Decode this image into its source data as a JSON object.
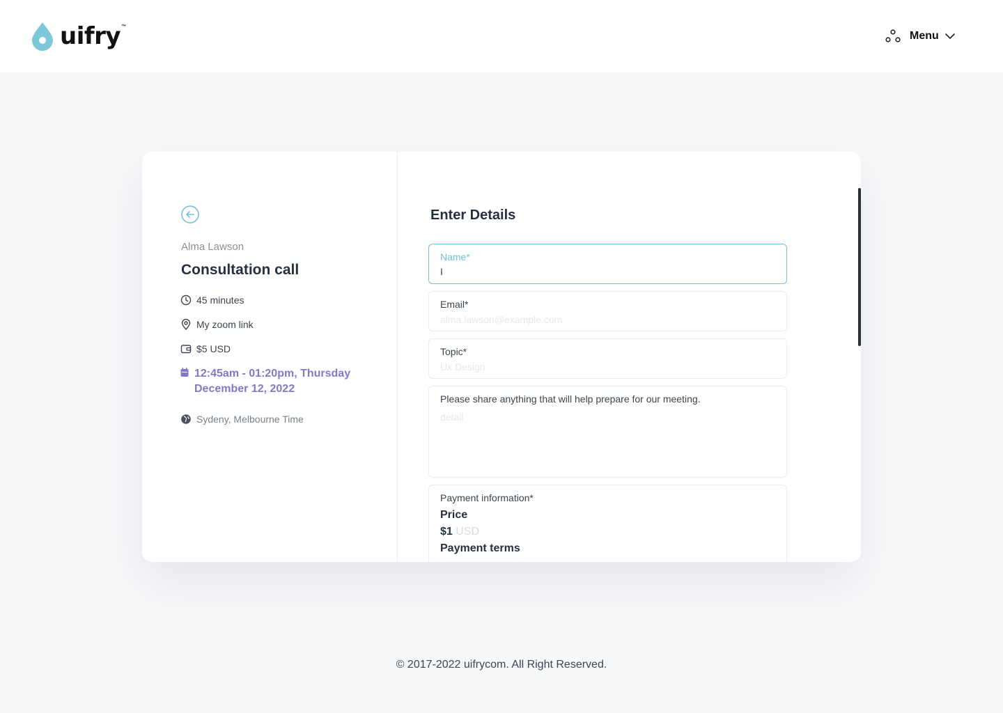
{
  "header": {
    "logo_text": "uifry",
    "logo_tm": "™",
    "menu_label": "Menu"
  },
  "event": {
    "host": "Alma Lawson",
    "title": "Consultation call",
    "duration": "45 minutes",
    "location": "My zoom link",
    "price": "$5 USD",
    "date_line1": "12:45am - 01:20pm, Thursday",
    "date_line2": "December 12, 2022",
    "timezone": "Sydeny, Melbourne Time"
  },
  "form": {
    "title": "Enter Details",
    "name": {
      "label": "Name*",
      "value": "I"
    },
    "email": {
      "label": "Email*",
      "placeholder": "alma.lawson@example.com"
    },
    "topic": {
      "label": "Topic*",
      "placeholder": "Ux Design"
    },
    "notes": {
      "label": "Please share anything that will help prepare for our meeting.",
      "placeholder": "detail"
    },
    "payment": {
      "label": "Payment information*",
      "price_label": "Price",
      "amount": "$1",
      "currency": "USD",
      "terms_label": "Payment terms"
    }
  },
  "footer": {
    "copyright": "© 2017-2022  uifrycom. All Right Reserved."
  },
  "colors": {
    "accent": "#6dc3d7",
    "date_purple": "#8379c9",
    "background": "#f7f8fa"
  }
}
